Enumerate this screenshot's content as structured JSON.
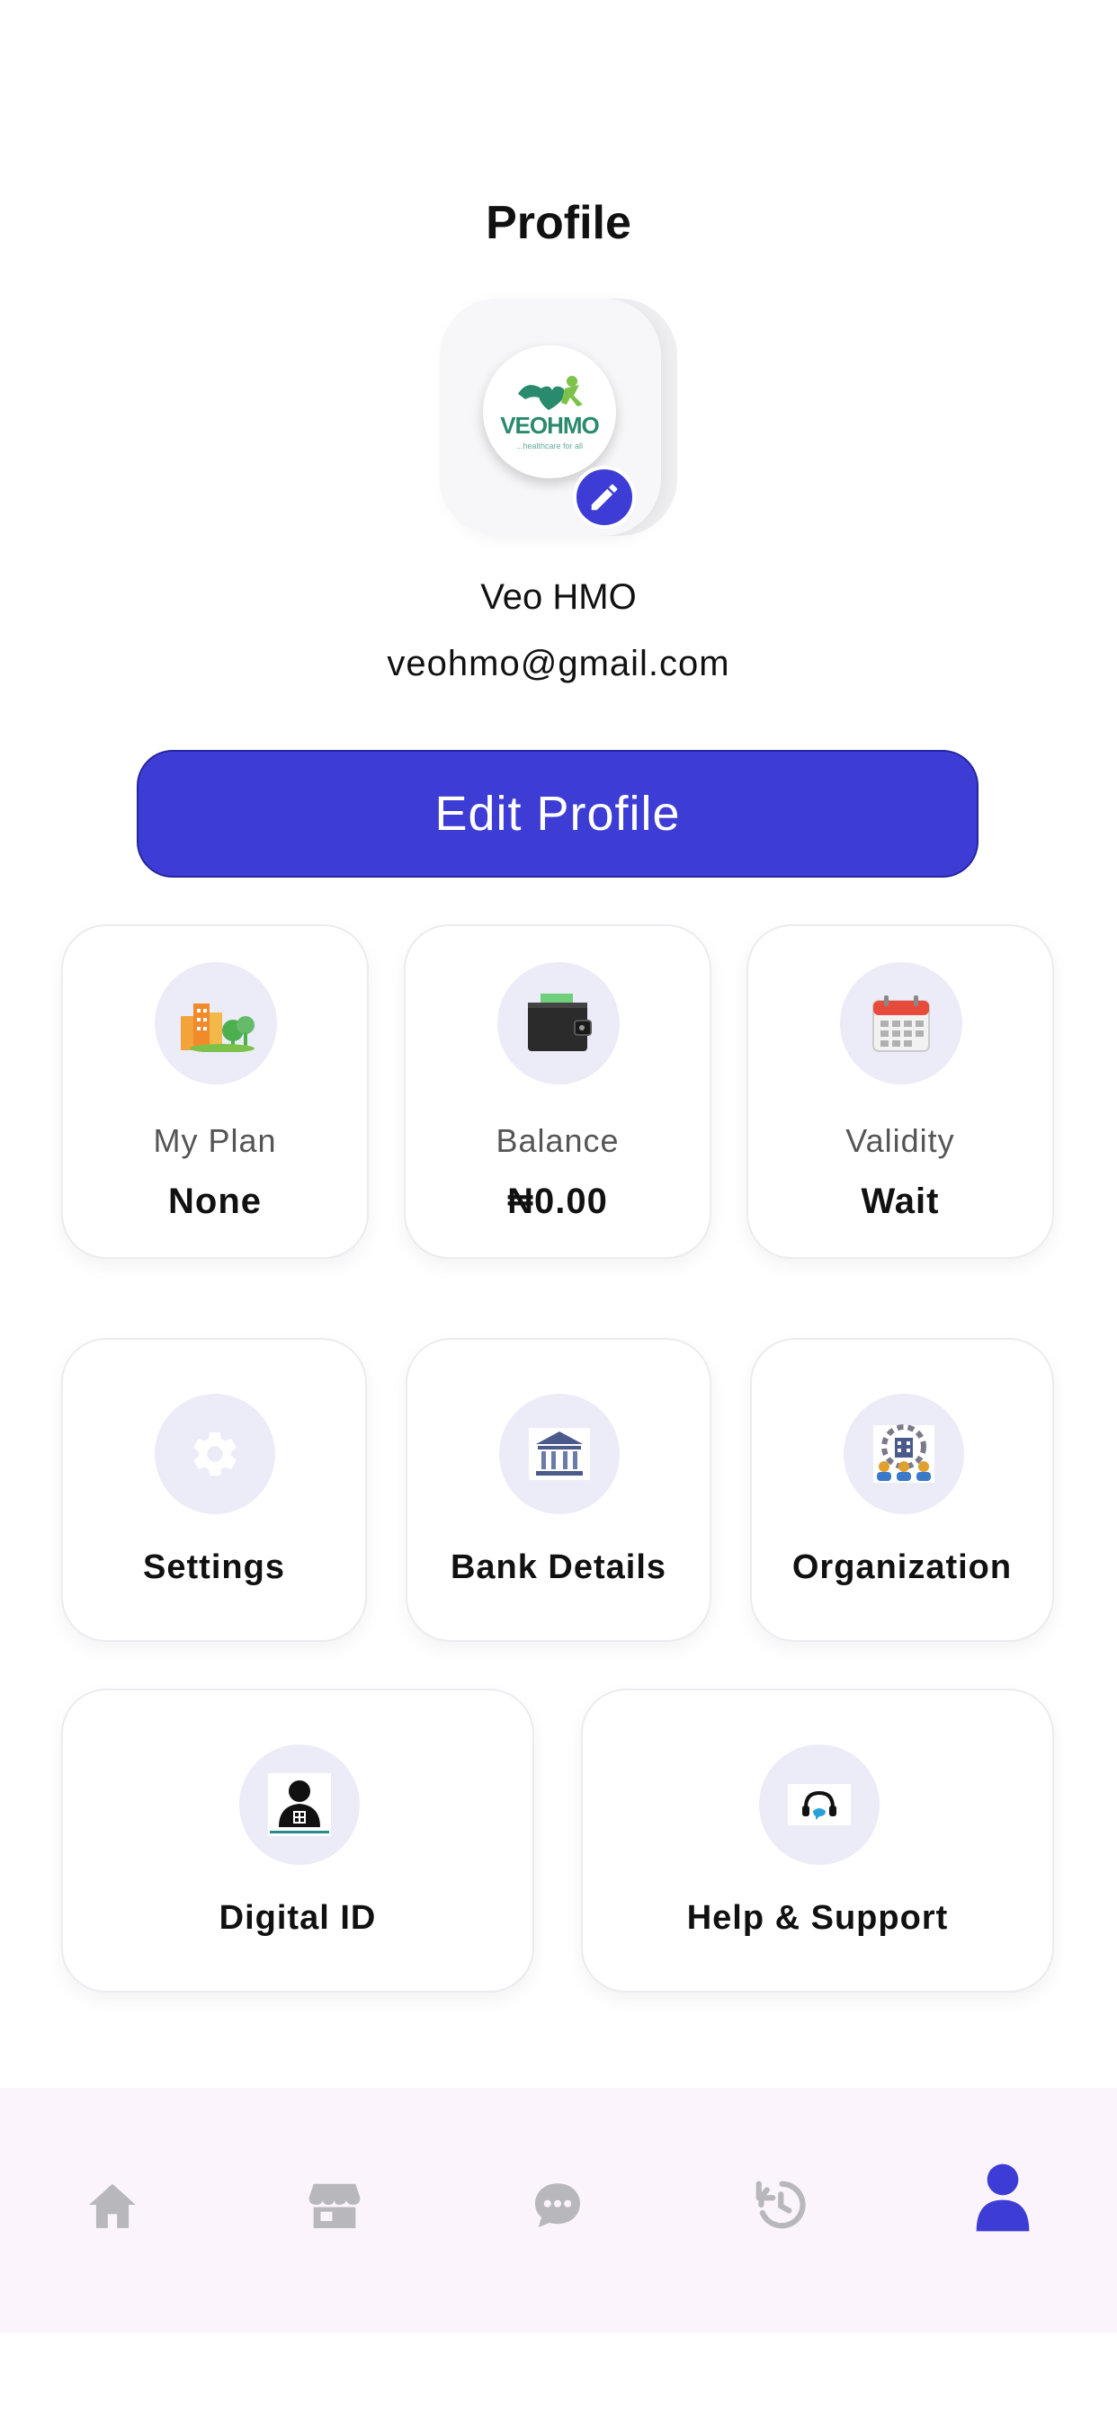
{
  "header": {
    "title": "Profile"
  },
  "profile": {
    "logo_text": "VEOHMO",
    "logo_tagline": "...healthcare for all",
    "name": "Veo HMO",
    "email": "veohmo@gmail.com",
    "edit_button_label": "Edit Profile"
  },
  "stats": [
    {
      "icon": "city-plan-icon",
      "label": "My Plan",
      "value": "None"
    },
    {
      "icon": "wallet-icon",
      "label": "Balance",
      "value": "₦0.00"
    },
    {
      "icon": "calendar-icon",
      "label": "Validity",
      "value": "Wait"
    }
  ],
  "menu_row1": [
    {
      "icon": "gear-icon",
      "label": "Settings"
    },
    {
      "icon": "bank-icon",
      "label": "Bank Details"
    },
    {
      "icon": "organization-icon",
      "label": "Organization"
    }
  ],
  "menu_row2": [
    {
      "icon": "digital-id-icon",
      "label": "Digital ID"
    },
    {
      "icon": "headset-support-icon",
      "label": "Help & Support"
    }
  ],
  "bottom_nav": [
    {
      "icon": "home-icon",
      "active": false
    },
    {
      "icon": "store-icon",
      "active": false
    },
    {
      "icon": "chat-icon",
      "active": false
    },
    {
      "icon": "history-icon",
      "active": false
    },
    {
      "icon": "profile-icon",
      "active": true
    }
  ],
  "colors": {
    "accent": "#3d3dd6",
    "icon_circle_bg": "#ececf8",
    "inactive_nav": "#b8b8bc",
    "nav_bg": "#fcf4fc"
  }
}
